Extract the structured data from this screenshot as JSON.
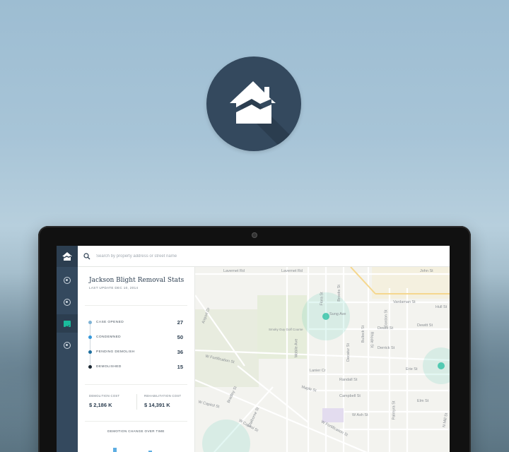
{
  "app": {
    "logo_icon": "house-crack-icon",
    "brand_color": "#34495e",
    "accent_color": "#1abc9c"
  },
  "search": {
    "placeholder": "Search by property address or street name",
    "icon": "search-icon"
  },
  "sidebar": {
    "items": [
      {
        "icon": "compass-icon",
        "active": false
      },
      {
        "icon": "target-icon",
        "active": false
      },
      {
        "icon": "chart-icon",
        "active": true
      },
      {
        "icon": "info-icon",
        "active": false
      }
    ]
  },
  "stats": {
    "title": "Jackson Blight Removal Stats",
    "last_update": "LAST UPDATE DEC 10, 2014",
    "rows": [
      {
        "label": "CASE OPENED",
        "value": "27",
        "color": "#7fb3d5"
      },
      {
        "label": "CONDEMNED",
        "value": "50",
        "color": "#3498db"
      },
      {
        "label": "PENDING DEMOLISH",
        "value": "36",
        "color": "#1f6f9f"
      },
      {
        "label": "DEMOLISHED",
        "value": "15",
        "color": "#1c2833"
      }
    ],
    "demolition_cost_label": "DEMOLITION COST",
    "demolition_cost_value": "$ 2,186 K",
    "rehab_cost_label": "REHABILITATION COST",
    "rehab_cost_value": "$ 14,391 K",
    "change_title": "DEMOTION CHANGE OVER TIME"
  },
  "map": {
    "streets": {
      "lavernet_rd": "Lavernet Rd",
      "lavernet_rd_2": "Lavernet Rd",
      "john_st": "John St",
      "flora_st": "Flora St",
      "brooks_st": "Brooks St",
      "airport_dr": "Airport Dr",
      "sung_ave": "Sung Ave",
      "gordon_st": "Gordon St",
      "vardaman_st": "Vardaman St",
      "hull_st": "Hull St",
      "mobile_ave": "Mobile Ave",
      "decatur_st": "Decatur St",
      "bullock_st": "Bullock St",
      "rhode_st": "Rhode St",
      "dewitt_st": "Dewitt St",
      "dewitt_st_2": "Dewitt St",
      "derrick_st": "Derrick St",
      "w_fortification_st": "W Fortification St",
      "erie_st": "Erie St",
      "lanier_cr": "Lanier Cr",
      "randall_st": "Randall St",
      "bradley_st": "Bradley St",
      "maple_st": "Maple St",
      "palmyra_st": "Palmyra St",
      "claiborne_st": "Claiborne St",
      "campbell_st": "Campbell St",
      "w_capitol_st": "W Capitol St",
      "w_capitol_st_2": "W Capitol St",
      "w_ash_st": "W Ash St",
      "elm_st": "Elm St",
      "w_fortification_st_2": "W Fortification St",
      "mill_st": "N Mill St",
      "golf_course": "Smoky Guy Golf Course"
    }
  }
}
